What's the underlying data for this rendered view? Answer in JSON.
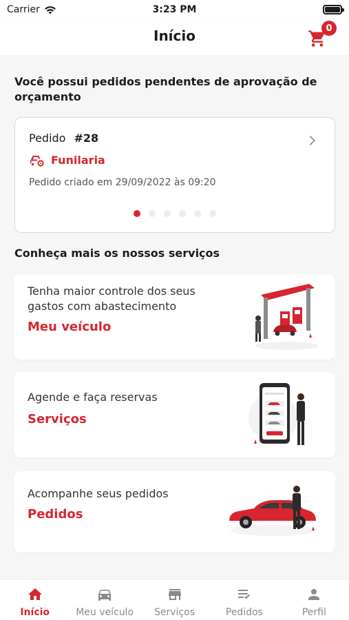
{
  "status_bar": {
    "carrier": "Carrier",
    "time": "3:23 PM"
  },
  "header": {
    "title": "Início",
    "cart_count": "0"
  },
  "pending": {
    "title": "Você possui pedidos pendentes de aprovação de orçamento",
    "order_label": "Pedido",
    "order_number": "#28",
    "service": "Funilaria",
    "created": "Pedido criado em 29/09/2022 às 09:20"
  },
  "services": {
    "title": "Conheça mais os nossos serviços",
    "cards": [
      {
        "desc": "Tenha maior controle dos seus gastos com abastecimento",
        "link": "Meu veículo"
      },
      {
        "desc": "Agende e faça reservas",
        "link": "Serviços"
      },
      {
        "desc": "Acompanhe seus pedidos",
        "link": "Pedidos"
      }
    ]
  },
  "tabs": [
    {
      "label": "Início",
      "icon": "home-icon"
    },
    {
      "label": "Meu veículo",
      "icon": "car-icon"
    },
    {
      "label": "Serviços",
      "icon": "store-icon"
    },
    {
      "label": "Pedidos",
      "icon": "checklist-icon"
    },
    {
      "label": "Perfil",
      "icon": "person-icon"
    }
  ],
  "colors": {
    "accent": "#d6262f",
    "background": "#f6f6f6",
    "inactive": "#8a8a8a"
  }
}
